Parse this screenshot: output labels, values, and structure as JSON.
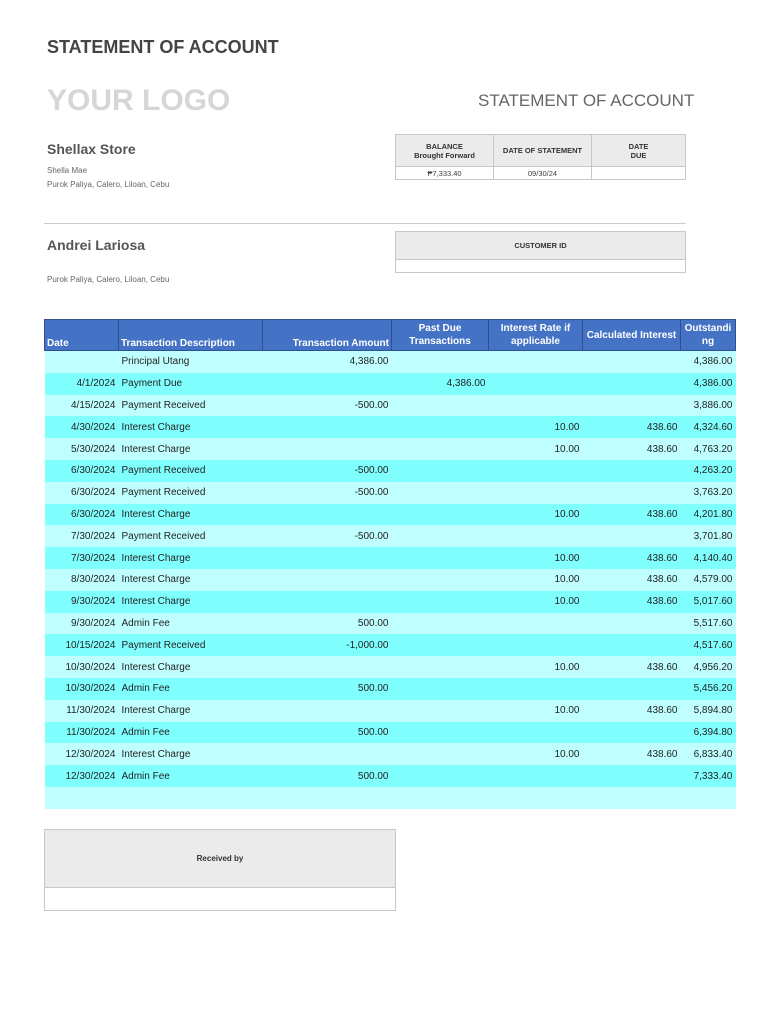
{
  "header": {
    "title": "STATEMENT OF ACCOUNT",
    "logo": "YOUR LOGO",
    "doc_title": "STATEMENT OF ACCOUNT"
  },
  "sender": {
    "store": "Shellax Store",
    "contact": "Shella Mae",
    "address": "Purok Paliya, Calero, Liloan, Cebu"
  },
  "summary": {
    "balance_label_1": "BALANCE",
    "balance_label_2": "Brought Forward",
    "date_statement_label": "DATE OF STATEMENT",
    "date_due_label_1": "DATE",
    "date_due_label_2": "DUE",
    "balance": "₱7,333.40",
    "date_statement": "09/30/24",
    "date_due": ""
  },
  "customer": {
    "name": "Andrei Lariosa",
    "address": "Purok Paliya, Calero, Liloan, Cebu",
    "id_label": "CUSTOMER ID",
    "id": ""
  },
  "table": {
    "headers": [
      "Date",
      "Transaction Description",
      "Transaction Amount",
      "Past Due Transactions",
      "Interest Rate if applicable",
      "Calculated Interest",
      "Outstanding"
    ],
    "rows": [
      [
        "",
        "Principal Utang",
        "4,386.00",
        "",
        "",
        "",
        "4,386.00"
      ],
      [
        "4/1/2024",
        "Payment Due",
        "",
        "4,386.00",
        "",
        "",
        "4,386.00"
      ],
      [
        "4/15/2024",
        "Payment Received",
        "-500.00",
        "",
        "",
        "",
        "3,886.00"
      ],
      [
        "4/30/2024",
        "Interest Charge",
        "",
        "",
        "10.00",
        "438.60",
        "4,324.60"
      ],
      [
        "5/30/2024",
        "Interest Charge",
        "",
        "",
        "10.00",
        "438.60",
        "4,763.20"
      ],
      [
        "6/30/2024",
        "Payment Received",
        "-500.00",
        "",
        "",
        "",
        "4,263.20"
      ],
      [
        "6/30/2024",
        "Payment Received",
        "-500.00",
        "",
        "",
        "",
        "3,763.20"
      ],
      [
        "6/30/2024",
        "Interest Charge",
        "",
        "",
        "10.00",
        "438.60",
        "4,201.80"
      ],
      [
        "7/30/2024",
        "Payment Received",
        "-500.00",
        "",
        "",
        "",
        "3,701.80"
      ],
      [
        "7/30/2024",
        "Interest Charge",
        "",
        "",
        "10.00",
        "438.60",
        "4,140.40"
      ],
      [
        "8/30/2024",
        "Interest Charge",
        "",
        "",
        "10.00",
        "438.60",
        "4,579.00"
      ],
      [
        "9/30/2024",
        "Interest Charge",
        "",
        "",
        "10.00",
        "438.60",
        "5,017.60"
      ],
      [
        "9/30/2024",
        "Admin Fee",
        "500.00",
        "",
        "",
        "",
        "5,517.60"
      ],
      [
        "10/15/2024",
        "Payment Received",
        "-1,000.00",
        "",
        "",
        "",
        "4,517.60"
      ],
      [
        "10/30/2024",
        "Interest Charge",
        "",
        "",
        "10.00",
        "438.60",
        "4,956.20"
      ],
      [
        "10/30/2024",
        "Admin Fee",
        "500.00",
        "",
        "",
        "",
        "5,456.20"
      ],
      [
        "11/30/2024",
        "Interest Charge",
        "",
        "",
        "10.00",
        "438.60",
        "5,894.80"
      ],
      [
        "11/30/2024",
        "Admin Fee",
        "500.00",
        "",
        "",
        "",
        "6,394.80"
      ],
      [
        "12/30/2024",
        "Interest Charge",
        "",
        "",
        "10.00",
        "438.60",
        "6,833.40"
      ],
      [
        "12/30/2024",
        "Admin Fee",
        "500.00",
        "",
        "",
        "",
        "7,333.40"
      ]
    ]
  },
  "received": {
    "label": "Received by",
    "value": ""
  }
}
